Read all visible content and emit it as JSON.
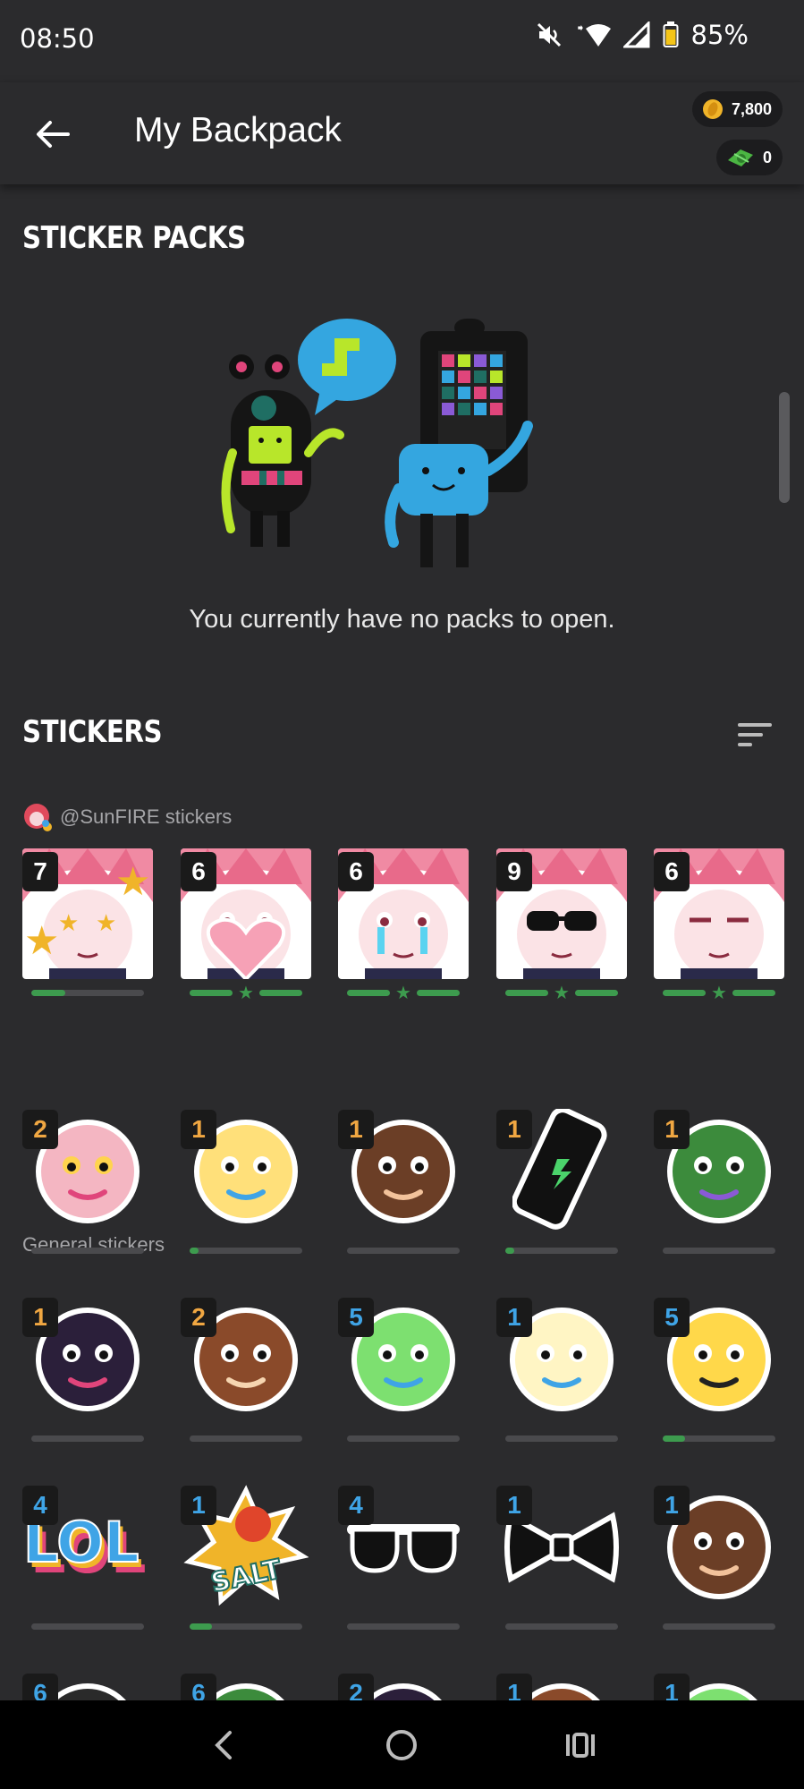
{
  "status_bar": {
    "time": "08:50",
    "battery": "85%"
  },
  "header": {
    "title": "My Backpack",
    "coins": "7,800",
    "gems": "0"
  },
  "packs": {
    "section_title": "STICKER PACKS",
    "empty_message": "You currently have no packs to open."
  },
  "stickers": {
    "section_title": "STICKERS"
  },
  "groups": {
    "sunfire": {
      "label": "@SunFIRE stickers"
    },
    "general": {
      "label": "General stickers"
    }
  },
  "sunfire_stickers": [
    {
      "count": "7",
      "icon": "starry-eyes-sticker",
      "progress": 0.3,
      "complete": false
    },
    {
      "count": "6",
      "icon": "heart-hug-sticker",
      "progress": 1,
      "complete": true
    },
    {
      "count": "6",
      "icon": "crying-sticker",
      "progress": 1,
      "complete": true
    },
    {
      "count": "9",
      "icon": "sunglasses-thumbs-sticker",
      "progress": 1,
      "complete": true
    },
    {
      "count": "6",
      "icon": "unimpressed-sticker",
      "progress": 1,
      "complete": true
    }
  ],
  "general_stickers": [
    {
      "count": "2",
      "icon": "nervous-emoji-sticker",
      "count_color": "#f0a742",
      "progress": 0
    },
    {
      "count": "1",
      "icon": "angry-bunny-sticker",
      "count_color": "#f0a742",
      "progress": 0.08
    },
    {
      "count": "1",
      "icon": "bob-ross-thumbs-up-sticker",
      "count_color": "#f0a742",
      "progress": 0
    },
    {
      "count": "1",
      "icon": "phone-sticker",
      "count_color": "#f0a742",
      "progress": 0.08
    },
    {
      "count": "1",
      "icon": "frog-sticker",
      "count_color": "#f0a742",
      "progress": 0
    },
    {
      "count": "1",
      "icon": "crow-sticker",
      "count_color": "#f0a742",
      "progress": 0
    },
    {
      "count": "2",
      "icon": "screaming-man-sticker",
      "count_color": "#f0a742",
      "progress": 0
    },
    {
      "count": "5",
      "icon": "zombie-girl-sticker",
      "count_color": "#3fa4e6",
      "progress": 0
    },
    {
      "count": "1",
      "icon": "confused-blob-sticker",
      "count_color": "#3fa4e6",
      "progress": 0
    },
    {
      "count": "5",
      "icon": "cool-thumbs-emoji-sticker",
      "count_color": "#3fa4e6",
      "progress": 0.2
    },
    {
      "count": "4",
      "icon": "lol-text-sticker",
      "count_color": "#3fa4e6",
      "progress": 0
    },
    {
      "count": "1",
      "icon": "salt-sticker",
      "count_color": "#3fa4e6",
      "progress": 0.2
    },
    {
      "count": "4",
      "icon": "sunglasses-sticker",
      "count_color": "#3fa4e6",
      "progress": 0
    },
    {
      "count": "1",
      "icon": "bow-tie-sticker",
      "count_color": "#3fa4e6",
      "progress": 0
    },
    {
      "count": "1",
      "icon": "green-slime-sticker",
      "count_color": "#3fa4e6",
      "progress": 0
    },
    {
      "count": "6",
      "icon": "peacock-sticker",
      "count_color": "#3fa4e6",
      "progress": 0
    },
    {
      "count": "6",
      "icon": "pencil-sticker",
      "count_color": "#3fa4e6",
      "progress": 0
    },
    {
      "count": "2",
      "icon": "dinosaur-sticker",
      "count_color": "#3fa4e6",
      "progress": 0
    },
    {
      "count": "1",
      "icon": "teal-hat-sticker",
      "count_color": "#3fa4e6",
      "progress": 0
    },
    {
      "count": "1",
      "icon": "bug-sticker",
      "count_color": "#3fa4e6",
      "progress": 0
    }
  ],
  "colors": {
    "background": "#2b2b2d",
    "progress": "#3d9b4e",
    "count_gold": "#f0a742",
    "count_blue": "#3fa4e6"
  }
}
